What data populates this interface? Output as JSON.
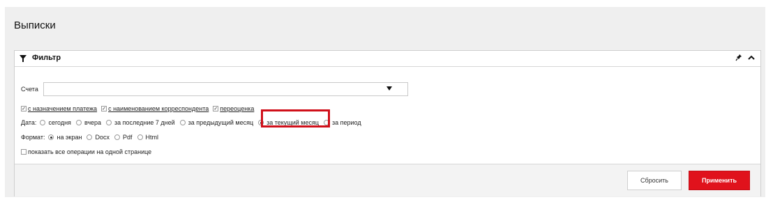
{
  "page": {
    "title": "Выписки"
  },
  "filter": {
    "title": "Фильтр",
    "accounts": {
      "label": "Счета",
      "value": ""
    },
    "checkboxes": [
      {
        "label": "с назначением платежа",
        "checked": true
      },
      {
        "label": "с наименованием корреспондента",
        "checked": true
      },
      {
        "label": "переоценка",
        "checked": true
      }
    ],
    "date": {
      "label": "Дата:",
      "options": [
        "сегодня",
        "вчера",
        "за последние 7 дней",
        "за предыдущий месяц",
        "за текущий месяц",
        "за период"
      ],
      "selected": "за текущий месяц"
    },
    "format": {
      "label": "Формат:",
      "options": [
        "на экран",
        "Docx",
        "Pdf",
        "Html"
      ],
      "selected": "на экран"
    },
    "all_ops": {
      "label": "показать все операции на одной странице",
      "checked": false
    },
    "check_mark": "✓"
  },
  "buttons": {
    "reset": "Сбросить",
    "apply": "Применить"
  },
  "colors": {
    "accent": "#e0121c",
    "highlight": "#d0101a"
  },
  "icons": {
    "filter": "filter-icon",
    "pin": "pin-icon",
    "collapse": "chevron-up-icon",
    "dropdown": "caret-down-icon"
  }
}
